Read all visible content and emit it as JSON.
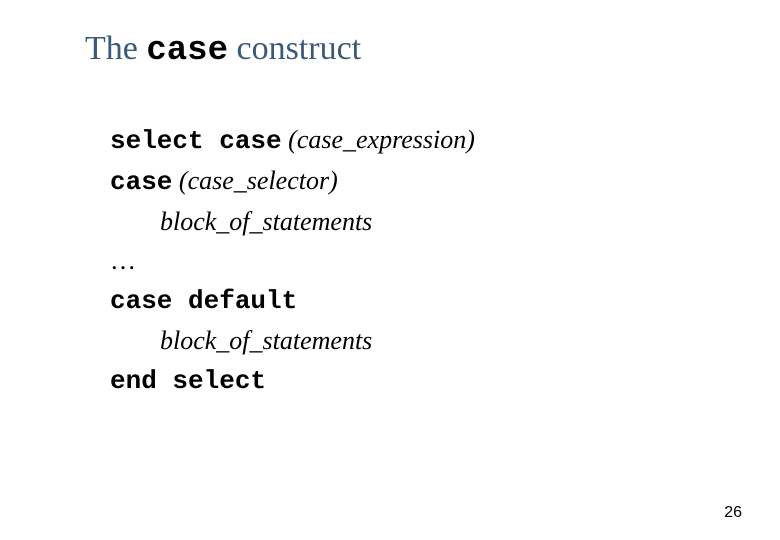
{
  "title": {
    "prefix": "The ",
    "mono": "case",
    "suffix": " construct"
  },
  "code": {
    "line1": {
      "kw": "select case",
      "open": " (",
      "expr": "case_expression",
      "close": ")"
    },
    "line2": {
      "kw": "case",
      "open": " (",
      "expr": "case_selector",
      "close": ")"
    },
    "line3": "block_of_statements",
    "line4": "…",
    "line5": "case default",
    "line6": "block_of_statements",
    "line7": "end select"
  },
  "page_number": "26"
}
